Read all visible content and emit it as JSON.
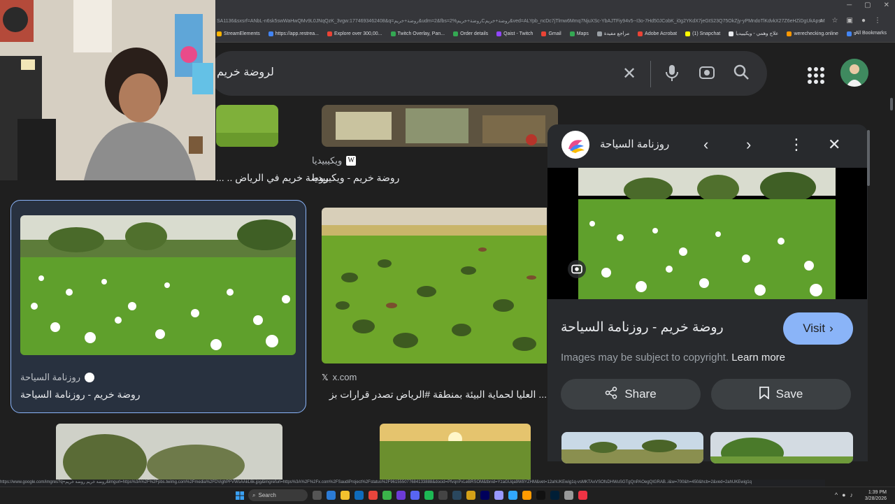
{
  "browser": {
    "url": "SA1136&sxsrf=ANbL-n6sk5swWaHwQMv9L0JNqQzK_3vgw:1774693462408&q=روضة+خريم&udm=2&fbs=روضة+خريم%2Cروضة+خريم&ved=ALYpb_ncDc7jTlmw6Mmq7NjuXSc-YbAJTFiy94v5--I3o-7Hd50JCobK_i0g2YKdX7jeGtS23Q75OkZjy-yPMndoTlKdvkX27Z6eHZiDgUkApsM05ely44KTOg4dFumk0DM4D...",
    "bookmarks": [
      {
        "label": "StreamElements",
        "color": "#ffb400"
      },
      {
        "label": "https://app.restrea...",
        "color": "#4285f4"
      },
      {
        "label": "Explore over 300,00...",
        "color": "#ea4335"
      },
      {
        "label": "Twitch Overlay, Pan...",
        "color": "#34a853"
      },
      {
        "label": "Order details",
        "color": "#34a853"
      },
      {
        "label": "Qaist - Twitch",
        "color": "#9146ff"
      },
      {
        "label": "Gmail",
        "color": "#ea4335"
      },
      {
        "label": "Maps",
        "color": "#34a853"
      },
      {
        "label": "مراجع مفيدة",
        "color": "#9aa0a6"
      },
      {
        "label": "Adobe Acrobat",
        "color": "#ea4335"
      },
      {
        "label": "(1) Snapchat",
        "color": "#fffc00"
      },
      {
        "label": "علاج وهمي - ويكيبيديا",
        "color": "#e8eaed"
      },
      {
        "label": "werechecking.online",
        "color": "#ff9800"
      },
      {
        "label": "s",
        "color": "#4285f4"
      }
    ],
    "all_bookmarks": "All Bookmarks"
  },
  "search": {
    "query": "لروضة خريم"
  },
  "results": {
    "top_left_caption": "روضة خريم في الرياض .. ...",
    "top_mid_source": "ويكيبيديا",
    "top_mid_caption": "روضة خريم - ويكيبيديا",
    "sel_source": "روزنامة السياحة",
    "sel_caption": "روضة خريم - روزنامة السياحة",
    "mid_source": "x.com",
    "mid_caption": "... العليا لحماية البيئة بمنطقة #الرياض تصدر قرارات بز"
  },
  "panel": {
    "site_name": "روزنامة السياحة",
    "title": "روضة خريم - روزنامة السياحة",
    "visit_label": "Visit",
    "copyright_text": "Images may be subject to copyright.",
    "learn_more": "Learn more",
    "share_label": "Share",
    "save_label": "Save"
  },
  "statusbar": {
    "text": "https://www.google.com/imgres?q=روضة خريم روضة خريم&imgurl=https%3A%2F%2Fpbs.twimg.com%2Fmedia%2FDVighPFVWsAAkL6k.jpg&imgrefurl=https%3A%2F%2Fx.com%2FSaudiProject%2Fstatus%2F961555077684133888&docid=PfvqnPxLeBRSOM&tbnid=YzaGUqa9W8YZHM&vet=12ahUKEwig1q-vsMKTAxVSOfsDHWuSGTgQnPAOegQIGRAB..i&w=700&h=450&hcb=2&ved=2ahUKEwig1q"
  },
  "taskbar": {
    "search_label": "Search",
    "time": "1:39 PM",
    "date": "3/28/2026"
  }
}
